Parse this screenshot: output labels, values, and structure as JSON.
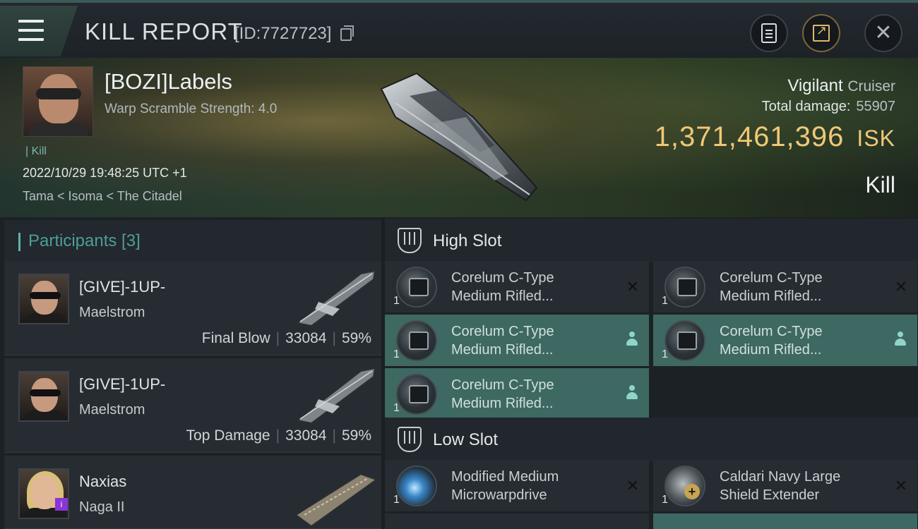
{
  "header": {
    "title": "KILL REPORT",
    "report_id": "[ID:7727723]"
  },
  "victim": {
    "pilot_name": "[BOZI]Labels",
    "detail": "Warp Scramble Strength: 4.0",
    "kill_tag": "Kill",
    "datetime": "2022/10/29 19:48:25 UTC +1",
    "location": "Tama < Isoma < The Citadel",
    "ship_name": "Vigilant",
    "ship_class": "Cruiser",
    "total_damage_label": "Total damage:",
    "total_damage": "55907",
    "isk_value": "1,371,461,396",
    "isk_currency": "ISK",
    "result": "Kill"
  },
  "participants": {
    "title": "Participants [3]",
    "rows": [
      {
        "name": "[GIVE]-1UP-",
        "ship": "Maelstrom",
        "role": "Final Blow",
        "damage": "33084",
        "percent": "59%"
      },
      {
        "name": "[GIVE]-1UP-",
        "ship": "Maelstrom",
        "role": "Top Damage",
        "damage": "33084",
        "percent": "59%"
      },
      {
        "name": "Naxias",
        "ship": "Naga II",
        "badge": "i"
      }
    ]
  },
  "slots": {
    "high": {
      "title": "High Slot",
      "modules": [
        {
          "qty": "1",
          "line1": "Corelum C-Type",
          "line2": "Medium Rifled...",
          "status": "destroyed"
        },
        {
          "qty": "1",
          "line1": "Corelum C-Type",
          "line2": "Medium Rifled...",
          "status": "destroyed"
        },
        {
          "qty": "1",
          "line1": "Corelum C-Type",
          "line2": "Medium Rifled...",
          "status": "dropped"
        },
        {
          "qty": "1",
          "line1": "Corelum C-Type",
          "line2": "Medium Rifled...",
          "status": "dropped"
        },
        {
          "qty": "1",
          "line1": "Corelum C-Type",
          "line2": "Medium Rifled...",
          "status": "dropped"
        }
      ]
    },
    "low": {
      "title": "Low Slot",
      "modules": [
        {
          "qty": "1",
          "line1": "Modified Medium",
          "line2": "Microwarpdrive",
          "status": "destroyed",
          "icon": "microwarpdrive-icon"
        },
        {
          "qty": "1",
          "line1": "Caldari Navy Large",
          "line2": "Shield Extender",
          "status": "destroyed",
          "icon": "shield-extender-icon"
        }
      ]
    }
  },
  "colors": {
    "accent": "#5fb3aa",
    "isk_gold": "#f0c877",
    "dropped_row": "#3e6862"
  }
}
